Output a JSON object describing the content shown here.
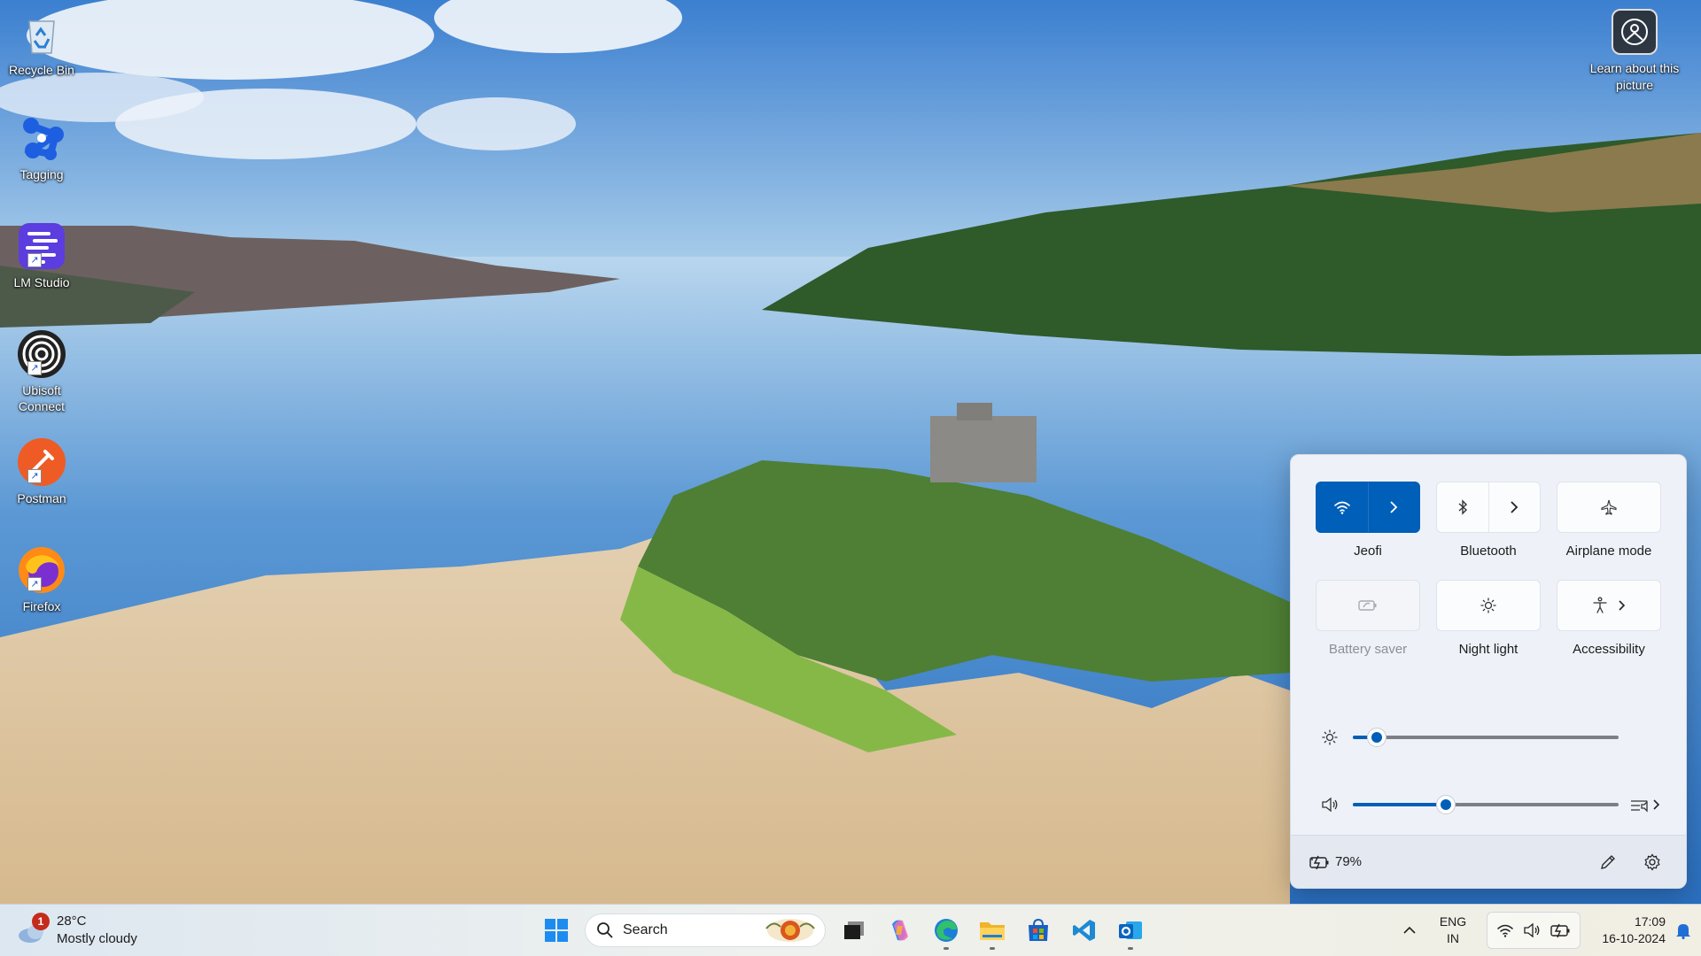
{
  "desktop": {
    "icons": [
      {
        "name": "recycle-bin",
        "label": "Recycle Bin"
      },
      {
        "name": "tagging",
        "label": "Tagging"
      },
      {
        "name": "lm-studio",
        "label": "LM Studio"
      },
      {
        "name": "ubisoft-connect",
        "label": "Ubisoft Connect"
      },
      {
        "name": "postman",
        "label": "Postman"
      },
      {
        "name": "firefox",
        "label": "Firefox"
      }
    ],
    "learn_about_picture": "Learn about this picture"
  },
  "quick_settings": {
    "tiles": [
      {
        "label": "Jeofi",
        "icon": "wifi-icon",
        "state": "on",
        "expandable": true
      },
      {
        "label": "Bluetooth",
        "icon": "bluetooth-icon",
        "state": "off",
        "expandable": true
      },
      {
        "label": "Airplane mode",
        "icon": "airplane-icon",
        "state": "off",
        "expandable": false
      },
      {
        "label": "Battery saver",
        "icon": "battery-saver-icon",
        "state": "disabled",
        "expandable": false
      },
      {
        "label": "Night light",
        "icon": "night-light-icon",
        "state": "off",
        "expandable": false
      },
      {
        "label": "Accessibility",
        "icon": "accessibility-icon",
        "state": "off",
        "expandable": true
      }
    ],
    "brightness_level": 0.09,
    "volume_level": 0.35,
    "battery": "79%"
  },
  "taskbar": {
    "weather": {
      "temperature": "28°C",
      "condition": "Mostly cloudy",
      "badge": "1"
    },
    "search_placeholder": "Search",
    "apps": [
      "start-icon",
      "task-view-icon",
      "copilot-icon",
      "edge-icon",
      "file-explorer-icon",
      "store-icon",
      "vscode-icon",
      "outlook-icon"
    ],
    "language": {
      "line1": "ENG",
      "line2": "IN"
    },
    "clock": {
      "time": "17:09",
      "date": "16-10-2024"
    }
  },
  "colors": {
    "accent": "#005fb8",
    "badge": "#c42b1c"
  }
}
